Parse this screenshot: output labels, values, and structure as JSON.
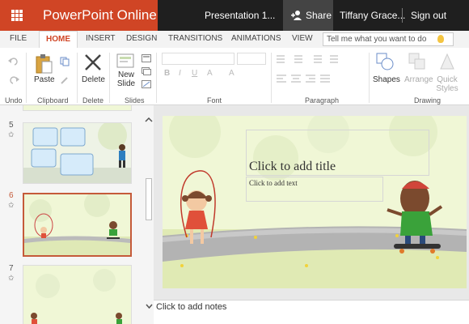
{
  "app": {
    "name": "PowerPoint Online",
    "doc_title": "Presentation 1...",
    "share_label": "Share",
    "user_name": "Tiffany Grace...",
    "signout_label": "Sign out"
  },
  "colors": {
    "brand": "#d04525",
    "titlebar": "#1f1f1f",
    "selected_slide_border": "#c55a3a",
    "slide_bg": "#f0f7d6"
  },
  "tabs": [
    {
      "label": "FILE"
    },
    {
      "label": "HOME"
    },
    {
      "label": "INSERT"
    },
    {
      "label": "DESIGN"
    },
    {
      "label": "TRANSITIONS"
    },
    {
      "label": "ANIMATIONS"
    },
    {
      "label": "VIEW"
    }
  ],
  "tell_me": {
    "placeholder": "Tell me what you want to do"
  },
  "ribbon": {
    "groups": {
      "undo": "Undo",
      "clipboard": "Clipboard",
      "delete": "Delete",
      "slides": "Slides",
      "font": "Font",
      "paragraph": "Paragraph",
      "drawing": "Drawing"
    },
    "buttons": {
      "paste": "Paste",
      "delete": "Delete",
      "new_slide": "New Slide",
      "shapes": "Shapes",
      "arrange": "Arrange",
      "quick_styles": "Quick Styles"
    }
  },
  "slides": [
    {
      "number": "5",
      "icon": "star-icon"
    },
    {
      "number": "6",
      "icon": "star-icon",
      "selected": true
    },
    {
      "number": "7",
      "icon": "star-icon"
    }
  ],
  "slide": {
    "title_placeholder": "Click to add title",
    "body_placeholder": "Click to add text"
  },
  "notes": {
    "placeholder": "Click to add notes"
  }
}
